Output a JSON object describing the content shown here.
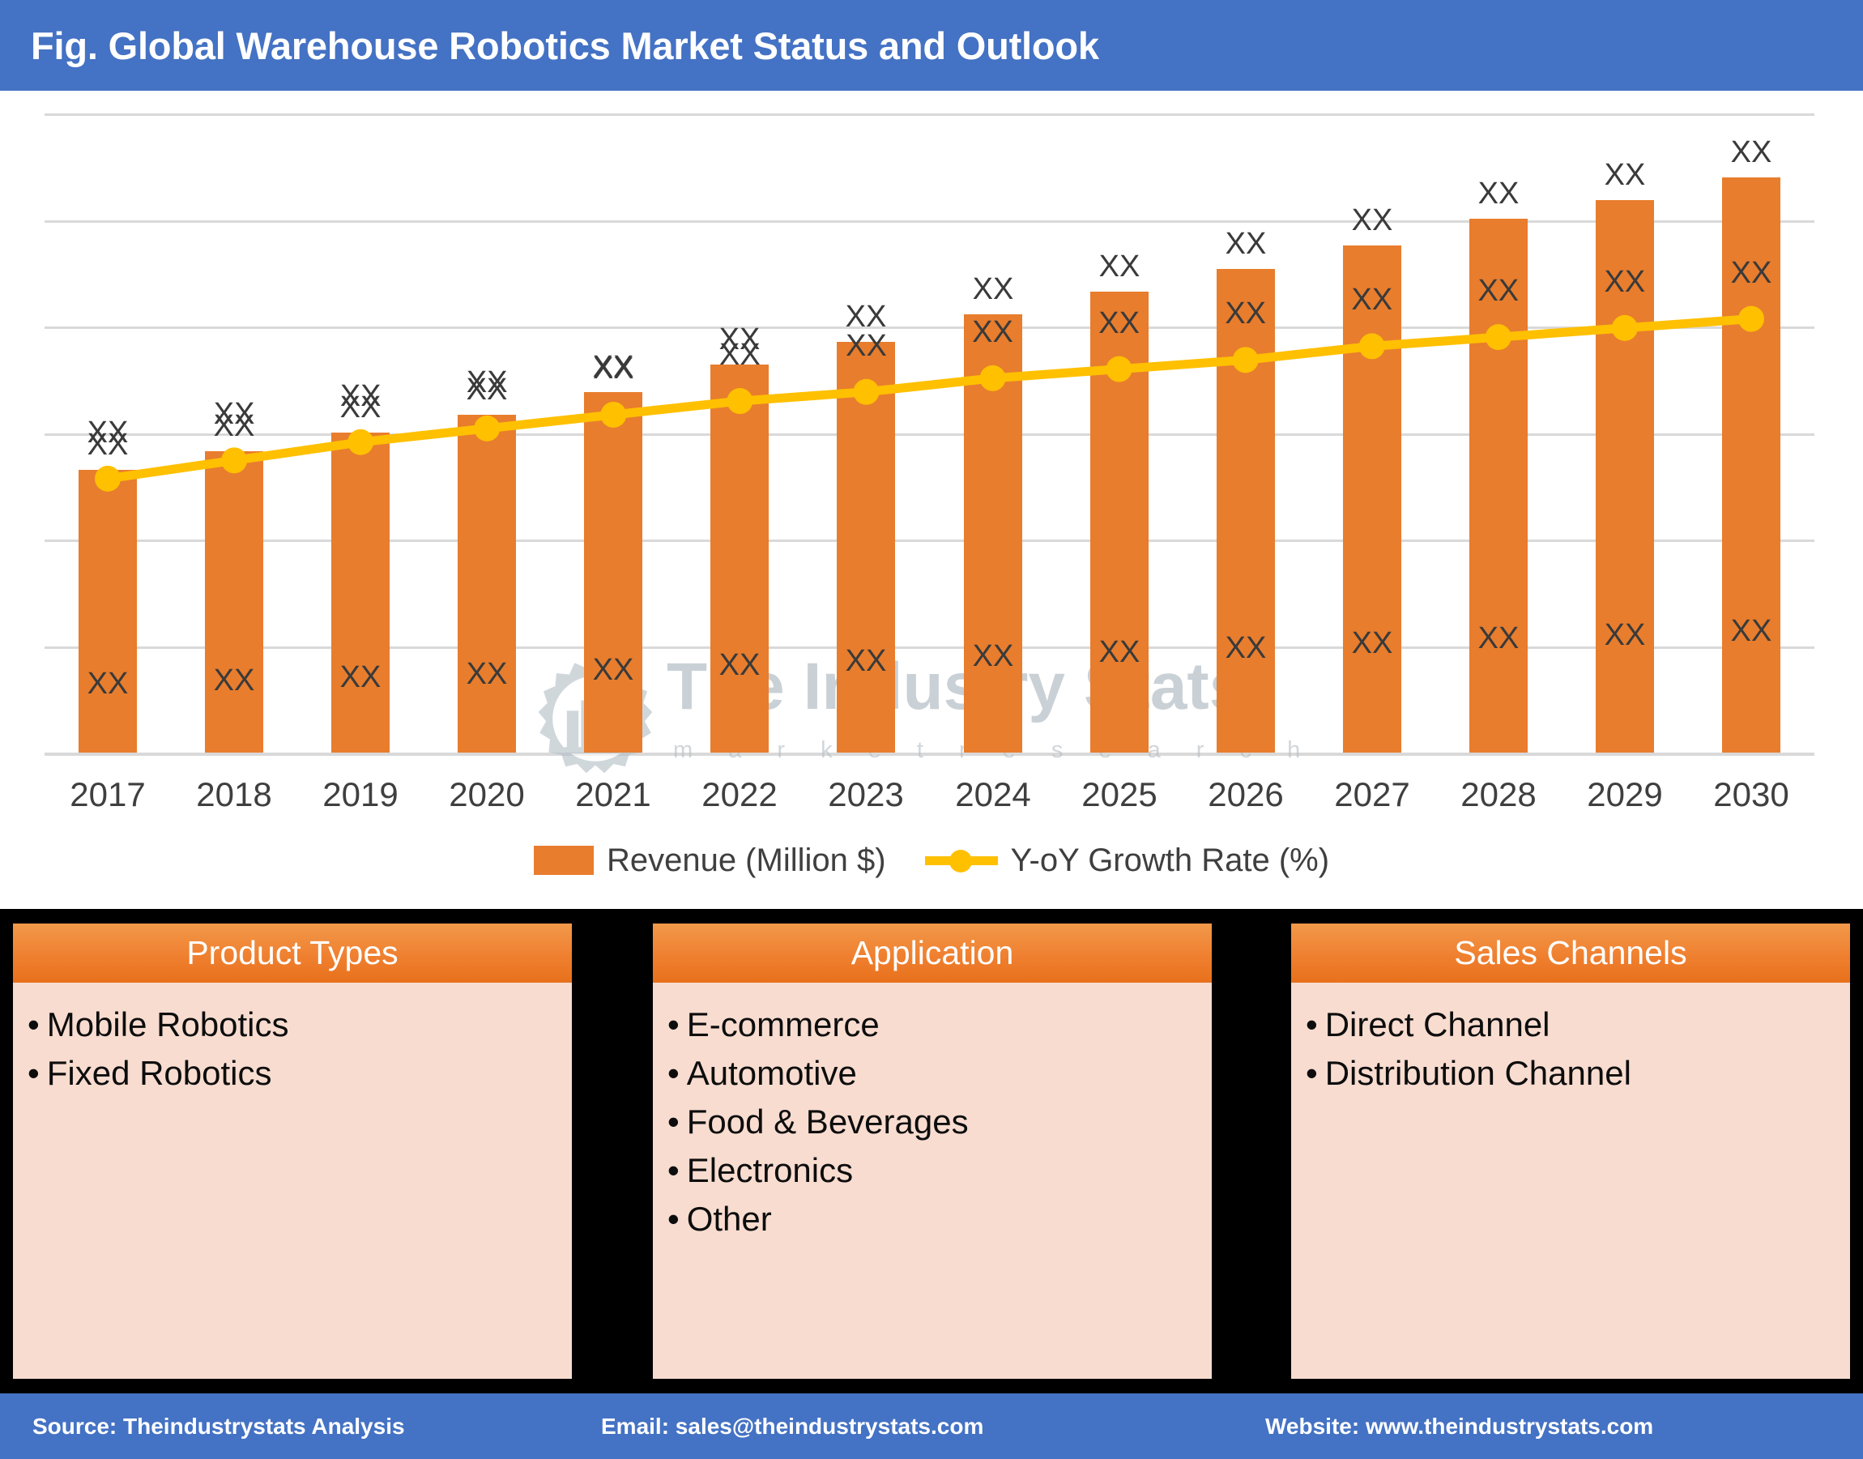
{
  "header": {
    "title": "Fig. Global Warehouse Robotics Market Status and Outlook",
    "background_color": "#4472C4"
  },
  "watermark": {
    "brand": "The Industry Stats",
    "tagline": "m a r k e t   r e s e a r c h",
    "logo_icon": "gear-factory-wrench-logo"
  },
  "chart_data": {
    "type": "bar",
    "title": "Fig. Global Warehouse Robotics Market Status and Outlook",
    "xlabel": "",
    "ylabel": "",
    "grid": true,
    "legend_position": "bottom",
    "categories": [
      "2017",
      "2018",
      "2019",
      "2020",
      "2021",
      "2022",
      "2023",
      "2024",
      "2025",
      "2026",
      "2027",
      "2028",
      "2029",
      "2030"
    ],
    "series": [
      {
        "name": "Revenue (Million $)",
        "type": "bar",
        "color": "#E87D2D",
        "axis": "left",
        "value_labels": [
          "XX",
          "XX",
          "XX",
          "XX",
          "XX",
          "XX",
          "XX",
          "XX",
          "XX",
          "XX",
          "XX",
          "XX",
          "XX",
          "XX"
        ],
        "top_labels": [
          "XX",
          "XX",
          "XX",
          "XX",
          "XX",
          "XX",
          "XX",
          "XX",
          "XX",
          "XX",
          "XX",
          "XX",
          "XX",
          "XX"
        ],
        "values": [
          62,
          66,
          70,
          74,
          79,
          85,
          90,
          96,
          101,
          106,
          111,
          117,
          121,
          126
        ]
      },
      {
        "name": "Y-oY Growth Rate (%)",
        "type": "line",
        "color": "#FFC000",
        "axis": "right",
        "marker": "circle",
        "value_labels": [
          "XX",
          "XX",
          "XX",
          "XX",
          "XX",
          "XX",
          "XX",
          "XX",
          "XX",
          "XX",
          "XX",
          "XX",
          "XX",
          "XX"
        ],
        "values": [
          60,
          64,
          68,
          71,
          74,
          77,
          79,
          82,
          84,
          86,
          89,
          91,
          93,
          95
        ]
      }
    ],
    "ylim": [
      0,
      140
    ],
    "gridline_count": 6,
    "note": "Values are masked as XX in the source figure; bar/line positions read off pixel heights."
  },
  "legend": {
    "items": [
      {
        "label": "Revenue (Million $)",
        "icon": "bar-swatch",
        "color": "#E87D2D"
      },
      {
        "label": "Y-oY Growth Rate (%)",
        "icon": "line-marker-swatch",
        "color": "#FFC000"
      }
    ]
  },
  "segments": {
    "background_color": "#000000",
    "panels": [
      {
        "title": "Product Types",
        "items": [
          "Mobile Robotics",
          "Fixed Robotics"
        ]
      },
      {
        "title": "Application",
        "items": [
          "E-commerce",
          "Automotive",
          "Food & Beverages",
          "Electronics",
          "Other"
        ]
      },
      {
        "title": "Sales Channels",
        "items": [
          "Direct Channel",
          "Distribution Channel"
        ]
      }
    ]
  },
  "footer": {
    "background_color": "#4472C4",
    "source": "Source: Theindustrystats Analysis",
    "email": "Email: sales@theindustrystats.com",
    "website": "Website: www.theindustrystats.com"
  }
}
